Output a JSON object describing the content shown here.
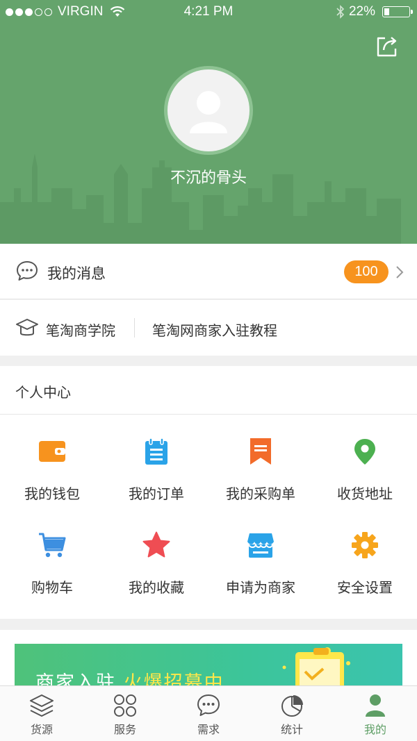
{
  "status_bar": {
    "carrier": "VIRGIN",
    "time": "4:21 PM",
    "battery": "22%",
    "battery_level": 0.22
  },
  "profile": {
    "username": "不沉的骨头"
  },
  "messages": {
    "label": "我的消息",
    "count": "100"
  },
  "academy": {
    "label": "笔淘商学院",
    "tutorial": "笔淘网商家入驻教程"
  },
  "personal_center": {
    "title": "个人中心",
    "items": [
      {
        "label": "我的钱包",
        "icon": "wallet-icon",
        "color": "#f7931e"
      },
      {
        "label": "我的订单",
        "icon": "clipboard-icon",
        "color": "#2aa3e8"
      },
      {
        "label": "我的采购单",
        "icon": "bookmark-icon",
        "color": "#f26b2a"
      },
      {
        "label": "收货地址",
        "icon": "location-pin-icon",
        "color": "#4cb050"
      },
      {
        "label": "购物车",
        "icon": "cart-icon",
        "color": "#3d8fe0"
      },
      {
        "label": "我的收藏",
        "icon": "star-icon",
        "color": "#ef4d53"
      },
      {
        "label": "申请为商家",
        "icon": "store-icon",
        "color": "#2aa3e8"
      },
      {
        "label": "安全设置",
        "icon": "gear-icon",
        "color": "#f7a51c"
      }
    ]
  },
  "banner": {
    "text_a": "商家入驻",
    "text_b": "火爆招募中"
  },
  "tabs": [
    {
      "label": "货源",
      "icon": "layers-icon"
    },
    {
      "label": "服务",
      "icon": "grid-icon"
    },
    {
      "label": "需求",
      "icon": "chat-icon"
    },
    {
      "label": "统计",
      "icon": "pie-chart-icon"
    },
    {
      "label": "我的",
      "icon": "person-icon",
      "active": true
    }
  ],
  "colors": {
    "header": "#65a46c",
    "badge": "#f7931e",
    "active_tab": "#5e9e65"
  }
}
